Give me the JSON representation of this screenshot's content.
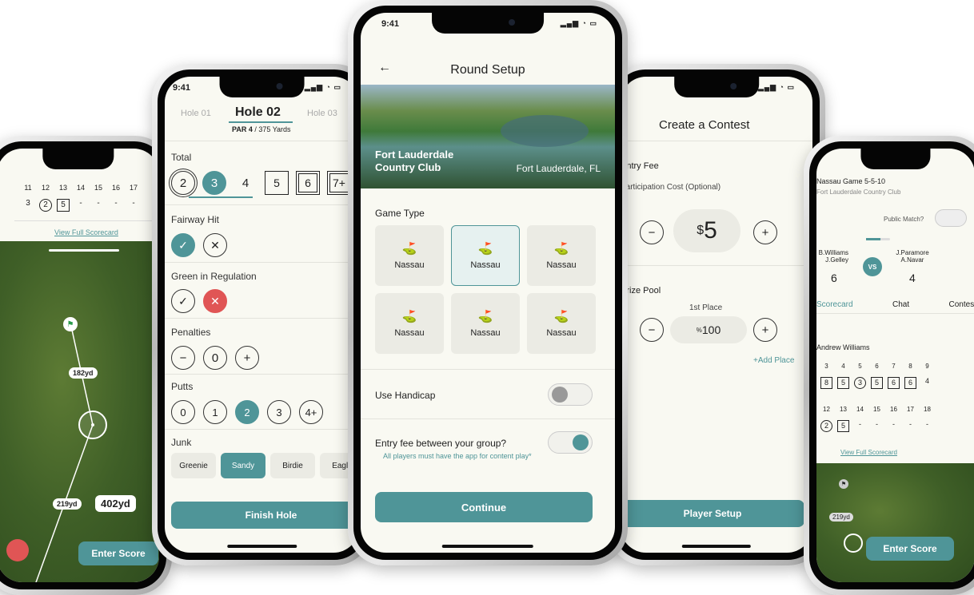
{
  "colors": {
    "accent": "#4f9598",
    "danger": "#e05555",
    "background": "#f9f9f2"
  },
  "status": {
    "time": "9:41",
    "signal": "signal-icon",
    "wifi": "wifi-icon",
    "battery": "battery-icon"
  },
  "phone1": {
    "holes": [
      "11",
      "12",
      "13",
      "14",
      "15",
      "16",
      "17"
    ],
    "scores": [
      "3",
      "2",
      "5",
      "-",
      "-",
      "-",
      "-"
    ],
    "link": "View Full Scorecard",
    "dist1": "182yd",
    "dist2": "219yd",
    "dist_total": "402yd",
    "enter": "Enter Score"
  },
  "phone2": {
    "holes": {
      "prev": "Hole 01",
      "current": "Hole 02",
      "next": "Hole 03"
    },
    "par_label": "PAR 4",
    "yards": "/ 375 Yards",
    "total_label": "Total",
    "totals": [
      "2",
      "3",
      "4",
      "5",
      "6",
      "7+"
    ],
    "fairway_label": "Fairway Hit",
    "gir_label": "Green in Regulation",
    "penalties_label": "Penalties",
    "penalties_value": "0",
    "putts_label": "Putts",
    "putts": [
      "0",
      "1",
      "2",
      "3",
      "4+"
    ],
    "junk_label": "Junk",
    "junk": [
      "Greenie",
      "Sandy",
      "Birdie",
      "Eagle"
    ],
    "finish": "Finish Hole"
  },
  "phone3": {
    "title": "Round Setup",
    "course": "Fort Lauderdale Country Club",
    "location": "Fort Lauderdale, FL",
    "game_type_label": "Game Type",
    "games": [
      "Nassau",
      "Nassau",
      "Nassau",
      "Nassau",
      "Nassau",
      "Nassau"
    ],
    "selected_game": 1,
    "handicap_label": "Use Handicap",
    "handicap_on": false,
    "entry_label": "Entry fee between your group?",
    "entry_on": true,
    "entry_note": "All players must have the app for content play*",
    "continue": "Continue"
  },
  "phone4": {
    "title": "Create a Contest",
    "fee_label": "Entry Fee",
    "cost_label": "Participation Cost (Optional)",
    "amount": "5",
    "currency": "$",
    "pool_label": "Prize Pool",
    "place_label": "1st Place",
    "pool_value": "100",
    "pool_unit": "%",
    "add_place": "+Add Place",
    "setup": "Player Setup"
  },
  "phone5": {
    "game_title": "Nassau Game 5-5-10",
    "course": "Fort Lauderdale Country Club",
    "public_label": "Public Match?",
    "team1": "B.Williams\nJ.Gelley",
    "team1_score": "6",
    "vs": "VS",
    "team2": "J.Paramore\nA.Navar",
    "team2_score": "4",
    "tabs": [
      "Scorecard",
      "Chat",
      "Contest"
    ],
    "player": "Andrew Williams",
    "holes_front": [
      "3",
      "4",
      "5",
      "6",
      "7",
      "8",
      "9"
    ],
    "scores_front": [
      "8",
      "5",
      "3",
      "5",
      "6",
      "6",
      "4"
    ],
    "holes_back": [
      "12",
      "13",
      "14",
      "15",
      "16",
      "17",
      "18"
    ],
    "scores_back": [
      "2",
      "5",
      "-",
      "-",
      "-",
      "-",
      "-"
    ],
    "link": "View Full Scorecard",
    "dist": "219yd",
    "enter": "Enter Score"
  }
}
